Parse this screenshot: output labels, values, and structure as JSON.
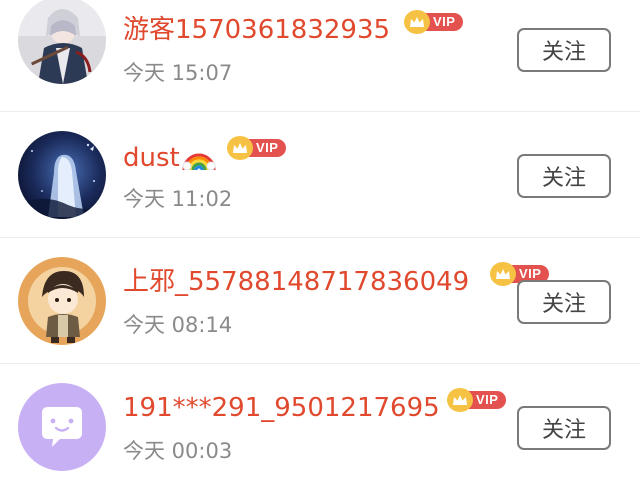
{
  "follow_list": {
    "items": [
      {
        "username": "游客1570361832935",
        "time": "今天 15:07",
        "vip_label": "VIP",
        "follow_label": "关注",
        "avatar": "anime-swordsman-avatar"
      },
      {
        "username": "dust",
        "username_suffix_icon": "rainbow-emoji-icon",
        "time": "今天 11:02",
        "vip_label": "VIP",
        "follow_label": "关注",
        "avatar": "night-sky-girl-avatar"
      },
      {
        "username": "上邪_55788148717836049",
        "time": "今天 08:14",
        "vip_label": "VIP",
        "follow_label": "关注",
        "avatar": "chibi-boy-avatar"
      },
      {
        "username": "191***291_9501217695",
        "time": "今天 00:03",
        "vip_label": "VIP",
        "follow_label": "关注",
        "avatar": "default-chat-bubble-avatar"
      }
    ]
  },
  "colors": {
    "username": "#e0492d",
    "time": "#8a8a8a",
    "vip_pill": "#e3524e",
    "vip_crown": "#f6c244",
    "button_border": "#7a7a7a",
    "divider": "#ececec",
    "default_avatar_bg": "#c8b0f4"
  }
}
